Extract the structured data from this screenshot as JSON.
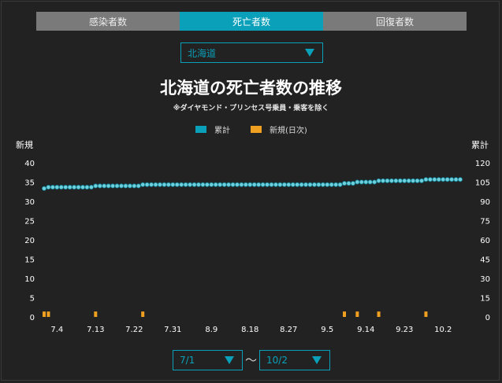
{
  "tabs": [
    {
      "label": "感染者数",
      "active": false
    },
    {
      "label": "死亡者数",
      "active": true
    },
    {
      "label": "回復者数",
      "active": false
    }
  ],
  "prefecture_select": {
    "value": "北海道"
  },
  "title": "北海道の死亡者数の推移",
  "subtitle": "※ダイヤモンド・プリンセス号乗員・乗客を除く",
  "legend": [
    {
      "label": "累計",
      "color": "#0aa0b9"
    },
    {
      "label": "新規(日次)",
      "color": "#f0a020"
    }
  ],
  "left_axis_title": "新規",
  "right_axis_title": "累計",
  "date_range": {
    "from": "7/1",
    "to": "10/2",
    "separator": "〜"
  },
  "colors": {
    "accent": "#0aa0b9",
    "new_bar": "#f0a020",
    "cumulative_line": "#6fd0dc",
    "background": "#222222"
  },
  "chart_data": {
    "type": "line",
    "x_start": "7/1",
    "x_end": "10/2",
    "x_tick_labels": [
      "7.4",
      "7.13",
      "7.22",
      "7.31",
      "8.9",
      "8.18",
      "8.27",
      "9.5",
      "9.14",
      "9.23",
      "10.2"
    ],
    "left_axis": {
      "label": "新規",
      "ticks": [
        0,
        5,
        10,
        15,
        20,
        25,
        30,
        35,
        40
      ],
      "range": [
        0,
        40
      ]
    },
    "right_axis": {
      "label": "累計",
      "ticks": [
        0,
        15,
        30,
        45,
        60,
        75,
        90,
        105,
        120
      ],
      "range": [
        0,
        120
      ]
    },
    "series": [
      {
        "name": "累計",
        "axis": "right",
        "values": [
          100,
          101,
          101,
          101,
          101,
          101,
          101,
          101,
          101,
          101,
          101,
          101,
          102,
          102,
          102,
          102,
          102,
          102,
          102,
          102,
          102,
          102,
          102,
          103,
          103,
          103,
          103,
          103,
          103,
          103,
          103,
          103,
          103,
          103,
          103,
          103,
          103,
          103,
          103,
          103,
          103,
          103,
          103,
          103,
          103,
          103,
          103,
          103,
          103,
          103,
          103,
          103,
          103,
          103,
          103,
          103,
          103,
          103,
          103,
          103,
          103,
          103,
          103,
          103,
          103,
          103,
          103,
          103,
          103,
          103,
          104,
          104,
          104,
          105,
          105,
          105,
          105,
          105,
          106,
          106,
          106,
          106,
          106,
          106,
          106,
          106,
          106,
          106,
          106,
          107,
          107,
          107,
          107,
          107,
          107,
          107,
          107,
          107
        ]
      },
      {
        "name": "新規(日次)",
        "axis": "left",
        "values": [
          1,
          1,
          0,
          0,
          0,
          0,
          0,
          0,
          0,
          0,
          0,
          0,
          1,
          0,
          0,
          0,
          0,
          0,
          0,
          0,
          0,
          0,
          0,
          1,
          0,
          0,
          0,
          0,
          0,
          0,
          0,
          0,
          0,
          0,
          0,
          0,
          0,
          0,
          0,
          0,
          0,
          0,
          0,
          0,
          0,
          0,
          0,
          0,
          0,
          0,
          0,
          0,
          0,
          0,
          0,
          0,
          0,
          0,
          0,
          0,
          0,
          0,
          0,
          0,
          0,
          0,
          0,
          0,
          0,
          0,
          1,
          0,
          0,
          1,
          0,
          0,
          0,
          0,
          1,
          0,
          0,
          0,
          0,
          0,
          0,
          0,
          0,
          0,
          0,
          1,
          0,
          0,
          0,
          0,
          0,
          0,
          0,
          0
        ]
      }
    ]
  }
}
